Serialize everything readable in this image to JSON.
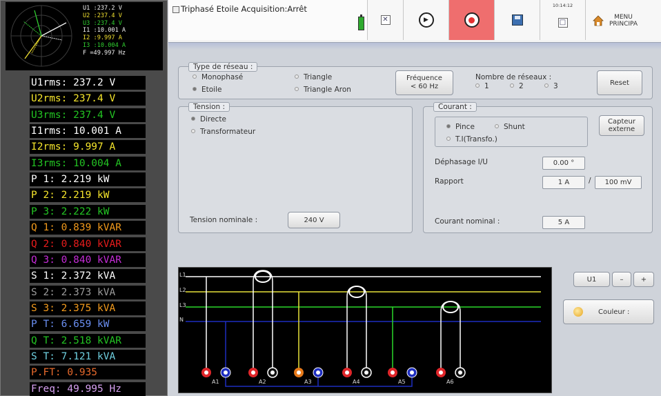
{
  "mini_display": {
    "lines": [
      {
        "text": "U1 :237.2 V",
        "color": "#f2f2f2"
      },
      {
        "text": "U2 :237.4 V",
        "color": "#f0e030"
      },
      {
        "text": "U3 :237.4 V",
        "color": "#30d030"
      },
      {
        "text": "I1 :10.001 A",
        "color": "#f2f2f2"
      },
      {
        "text": "I2 :9.997 A",
        "color": "#f0e030"
      },
      {
        "text": "I3 :10.004 A",
        "color": "#30d030"
      },
      {
        "text": "F  =49.997 Hz",
        "color": "#f2f2f2"
      }
    ]
  },
  "measurements": [
    {
      "text": "U1rms: 237.2 V",
      "color": "#ffffff"
    },
    {
      "text": "U2rms: 237.4 V",
      "color": "#f5e52c"
    },
    {
      "text": "U3rms: 237.4 V",
      "color": "#23c423"
    },
    {
      "text": "I1rms: 10.001 A",
      "color": "#ffffff"
    },
    {
      "text": "I2rms: 9.997 A",
      "color": "#f5e52c"
    },
    {
      "text": "I3rms: 10.004 A",
      "color": "#23c423"
    },
    {
      "text": "P 1: 2.219 kW",
      "color": "#ffffff"
    },
    {
      "text": "P 2: 2.219 kW",
      "color": "#f5e52c"
    },
    {
      "text": "P 3: 2.222 kW",
      "color": "#23c423"
    },
    {
      "text": "Q 1: 0.839 kVAR",
      "color": "#f29a1c"
    },
    {
      "text": "Q 2: 0.840 kVAR",
      "color": "#e81c1c"
    },
    {
      "text": "Q 3: 0.840 kVAR",
      "color": "#c52cd8"
    },
    {
      "text": "S 1: 2.372 kVA",
      "color": "#ffffff"
    },
    {
      "text": "S 2: 2.373 kVA",
      "color": "#9a9a9a"
    },
    {
      "text": "S 3: 2.375 kVA",
      "color": "#f29a1c"
    },
    {
      "text": "P T: 6.659 kW",
      "color": "#6a8ef0"
    },
    {
      "text": "Q T: 2.518 kVAR",
      "color": "#23c423"
    },
    {
      "text": "S T: 7.121 kVA",
      "color": "#6fd0e0"
    },
    {
      "text": "P.FT: 0.935",
      "color": "#e86a2c"
    },
    {
      "text": "Freq: 49.995 Hz",
      "color": "#d6a0f0"
    }
  ],
  "top_bar": {
    "title": "Triphasé Etoile Acquisition:Arrêt",
    "time": "10:14:12",
    "menu_line1": "MENU",
    "menu_line2": "PRINCIPA",
    "icons": {
      "battery": "battery-icon",
      "checkbox": "checkbox-icon",
      "play": "play-icon",
      "record": "record-icon",
      "save": "save-icon",
      "calendar": "calendar-icon",
      "home": "home-icon"
    }
  },
  "network_type": {
    "title": "Type de réseau :",
    "options": [
      "Monophasé",
      "Triangle",
      "Etoile",
      "Triangle Aron"
    ],
    "selected": "Etoile",
    "frequency_button": {
      "line1": "Fréquence",
      "line2": "< 60 Hz"
    },
    "network_count_label": "Nombre de réseaux :",
    "network_counts": [
      "1",
      "2",
      "3"
    ],
    "reset_label": "Reset"
  },
  "tension": {
    "title": "Tension :",
    "options": [
      "Directe",
      "Transformateur"
    ],
    "selected": "Directe",
    "nominal_label": "Tension nominale :",
    "nominal_value": "240 V"
  },
  "courant": {
    "title": "Courant   :",
    "options": [
      "Pince",
      "Shunt",
      "T.I(Transfo.)"
    ],
    "selected": "Pince",
    "capteur_line1": "Capteur",
    "capteur_line2": "externe",
    "dephasage_label": "Déphasage I/U",
    "dephasage_value": "0.00 °",
    "rapport_label": "Rapport",
    "rapport_value1": "1 A",
    "rapport_sep": "/",
    "rapport_value2": "100 mV",
    "nominal_label": "Courant nominal :",
    "nominal_value": "5 A"
  },
  "wiring": {
    "phase_labels": [
      "L1",
      "L2",
      "L3",
      "N"
    ],
    "channel_labels": [
      "A1",
      "A2",
      "A3",
      "A4",
      "A5",
      "A6"
    ],
    "colors": {
      "L1": "#ffffff",
      "L2": "#e8e23a",
      "L3": "#2ad82a",
      "N": "#1e2ec0",
      "red": "#e0262a"
    }
  },
  "right_controls": {
    "channel_value": "U1",
    "minus_label": "–",
    "plus_label": "+",
    "color_label": "Couleur :"
  }
}
